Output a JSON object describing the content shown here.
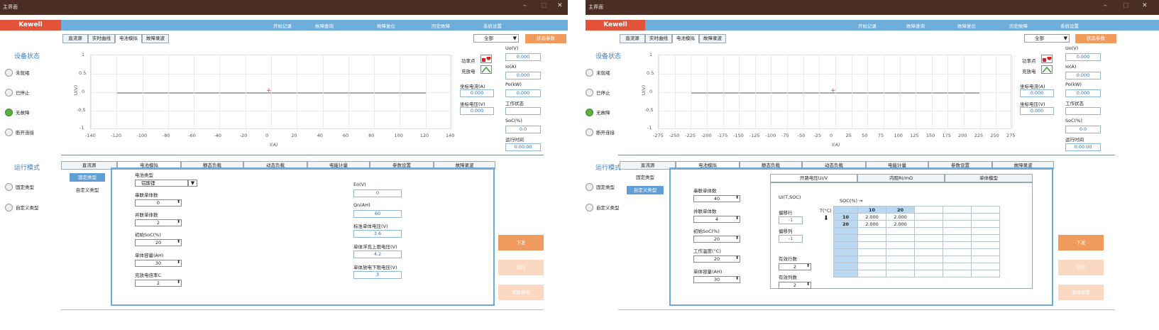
{
  "windows": [
    {
      "title": "主界面",
      "logo": "Kewell",
      "menu": [
        "开始记录",
        "故障查询",
        "故障复位",
        "历史故障",
        "系统设置"
      ],
      "top_tabs": [
        "直流源",
        "实时曲线",
        "电池模拟",
        "故障录波"
      ],
      "active_top_tab": 2,
      "filter": "全部",
      "status_button": "状态参数",
      "device_status_heading": "设备状态",
      "device_status": [
        "未就绪",
        "已停止",
        "无故障",
        "断开连接"
      ],
      "run_mode_heading": "运行模式",
      "run_modes": [
        "固定类型",
        "自定义类型"
      ],
      "chart": {
        "ylabel": "U(V)",
        "xlabel": "I(A)",
        "yticks": [
          "1",
          "0.5",
          "0",
          "-0.5",
          "-1"
        ],
        "xticks": [
          "-140",
          "-120",
          "-100",
          "-80",
          "-60",
          "-40",
          "-20",
          "0",
          "20",
          "40",
          "60",
          "80",
          "100",
          "120",
          "140"
        ]
      },
      "legend": {
        "power": "功率点",
        "charge": "充放电"
      },
      "coord_current_label": "坐标电流(A)",
      "coord_current": "0.000",
      "coord_voltage_label": "坐标电压(V)",
      "coord_voltage": "0.000",
      "status": {
        "uo_label": "Uo(V)",
        "uo": "0.000",
        "io_label": "Io(A)",
        "io": "0.000",
        "po_label": "Po(kW)",
        "po": "0.000",
        "work_label": "工作状态",
        "work": "",
        "soc_label": "SoC(%)",
        "soc": "0.0",
        "runtime_label": "运行时间",
        "runtime": "0:00:00"
      },
      "bottom_tabs": [
        "直流源",
        "电池模拟",
        "静态负载",
        "动态负载",
        "电能计量",
        "参数设置",
        "故障录波"
      ],
      "active_bottom_tab": 1,
      "subtabs": [
        "固定类型",
        "自定义类型"
      ],
      "active_subtab": 0,
      "form": {
        "battery_type_label": "电池类型",
        "battery_type": "铝酸锂",
        "series_label": "串联单体数",
        "series": "0",
        "parallel_label": "并联单体数",
        "parallel": "2",
        "init_soc_label": "初始SoC(%)",
        "init_soc": "20",
        "capacity_label": "单体容量(AH)",
        "capacity": "30",
        "rate_label": "充放电倍率C",
        "rate": "2"
      },
      "info": {
        "eo_label": "Eo(V)",
        "eo": "0",
        "qn_label": "Qn(AH)",
        "qn": "60",
        "nominal_label": "标准单体电压(V)",
        "nominal": "3.6",
        "upper_label": "单体浮充上限电压(V)",
        "upper": "4.2",
        "lower_label": "单体放电下限电压(V)",
        "lower": "3"
      },
      "actions": [
        "下发",
        "运行",
        "清除报警"
      ]
    },
    {
      "title": "主界面",
      "logo": "Kewell",
      "menu": [
        "开始记录",
        "故障查询",
        "故障复位",
        "历史故障",
        "系统设置"
      ],
      "top_tabs": [
        "直流源",
        "实时曲线",
        "电池模拟",
        "故障录波"
      ],
      "active_top_tab": 2,
      "filter": "全部",
      "status_button": "状态参数",
      "device_status_heading": "设备状态",
      "device_status": [
        "未就绪",
        "已停止",
        "无故障",
        "断开连接"
      ],
      "run_mode_heading": "运行模式",
      "run_modes": [
        "固定类型",
        "自定义类型"
      ],
      "chart": {
        "ylabel": "U(V)",
        "xlabel": "I(A)",
        "yticks": [
          "1",
          "0.5",
          "0",
          "-0.5",
          "-1"
        ],
        "xticks": [
          "-275",
          "-250",
          "-225",
          "-200",
          "-175",
          "-150",
          "-125",
          "-100",
          "-75",
          "-50",
          "-25",
          "0",
          "25",
          "50",
          "75",
          "100",
          "125",
          "150",
          "175",
          "200",
          "225",
          "250",
          "275"
        ]
      },
      "legend": {
        "power": "功率点",
        "charge": "充放电"
      },
      "coord_current_label": "坐标电流(A)",
      "coord_current": "0.000",
      "coord_voltage_label": "坐标电压(V)",
      "coord_voltage": "0.000",
      "status": {
        "uo_label": "Uo(V)",
        "uo": "0.000",
        "io_label": "Io(A)",
        "io": "0.000",
        "po_label": "Po(kW)",
        "po": "0.000",
        "work_label": "工作状态",
        "work": "",
        "soc_label": "SoC(%)",
        "soc": "0.0",
        "runtime_label": "运行时间",
        "runtime": "0:00:00"
      },
      "bottom_tabs": [
        "直流源",
        "电池模拟",
        "静态负载",
        "动态负载",
        "电能计量",
        "参数设置",
        "故障录波"
      ],
      "active_bottom_tab": 1,
      "subtabs": [
        "固定类型",
        "自定义类型"
      ],
      "active_subtab": 1,
      "form": {
        "series_label": "串联单体数",
        "series": "40",
        "parallel_label": "并联单体数",
        "parallel": "4",
        "init_soc_label": "初始SoC(%)",
        "init_soc": "20",
        "temp_label": "工作温度(°C)",
        "temp": "20",
        "capacity_label": "单体容量(AH)",
        "capacity": "30"
      },
      "inner_tabs": [
        "开路电压Ui/V",
        "内阻Ri/mΩ",
        "单体模型"
      ],
      "active_inner_tab": 0,
      "table_params": {
        "func_label": "Ui(T,SOC)",
        "row_offset_label": "偏移行",
        "row_offset": "-1",
        "col_offset_label": "偏移列",
        "col_offset": "-1",
        "valid_rows_label": "有效行数",
        "valid_rows": "2",
        "valid_cols_label": "有效列数",
        "valid_cols": "2"
      },
      "table": {
        "soc_axis": "SOC(%)",
        "temp_axis": "T(°C)",
        "col_headers": [
          "10",
          "20"
        ],
        "rows": [
          {
            "t": "10",
            "vals": [
              "2.000",
              "2.000"
            ]
          },
          {
            "t": "20",
            "vals": [
              "2.000",
              "2.000"
            ]
          }
        ]
      },
      "actions": [
        "下发",
        "运行",
        "清除报警"
      ]
    }
  ]
}
